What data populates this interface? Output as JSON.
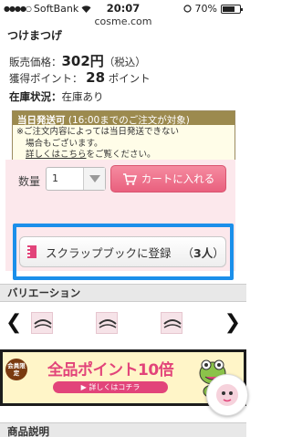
{
  "status_bar": {
    "carrier": "SoftBank",
    "time": "20:07",
    "battery": "70%",
    "battery_level": 0.7,
    "url": "cosme.com"
  },
  "product": {
    "name": "つけまつげ",
    "price_label": "販売価格：",
    "price_value": "302円",
    "price_tax": "（税込）",
    "points_label": "獲得ポイント：",
    "points_value": "28",
    "points_unit": "ポイント",
    "stock_label": "在庫状況：",
    "stock_value": "在庫あり"
  },
  "shipping": {
    "title": "当日発送可",
    "note": "(16:00までのご注文が対象)",
    "body_line1": "※ご注文内容によっては当日発送できない",
    "body_line2": "場合もございます。",
    "link_text": "詳しくはこちら",
    "link_suffix": "をご覧ください。"
  },
  "cart": {
    "qty_label": "数量",
    "qty_value": "1",
    "cart_button": "カートに入れる"
  },
  "scrapbook": {
    "label": "スクラップブックに登録",
    "count_prefix": "（",
    "count": "3人",
    "count_suffix": "）"
  },
  "sections": {
    "variation": "バリエーション",
    "description": "商品説明"
  },
  "banner": {
    "badge": "会員限定",
    "title": "全品ポイント10倍",
    "button": "▶ 詳しくはコチラ"
  },
  "colors": {
    "accent_pink": "#e9607e",
    "highlight_blue": "#1b8fea",
    "shipping_header": "#9c8a4e"
  }
}
